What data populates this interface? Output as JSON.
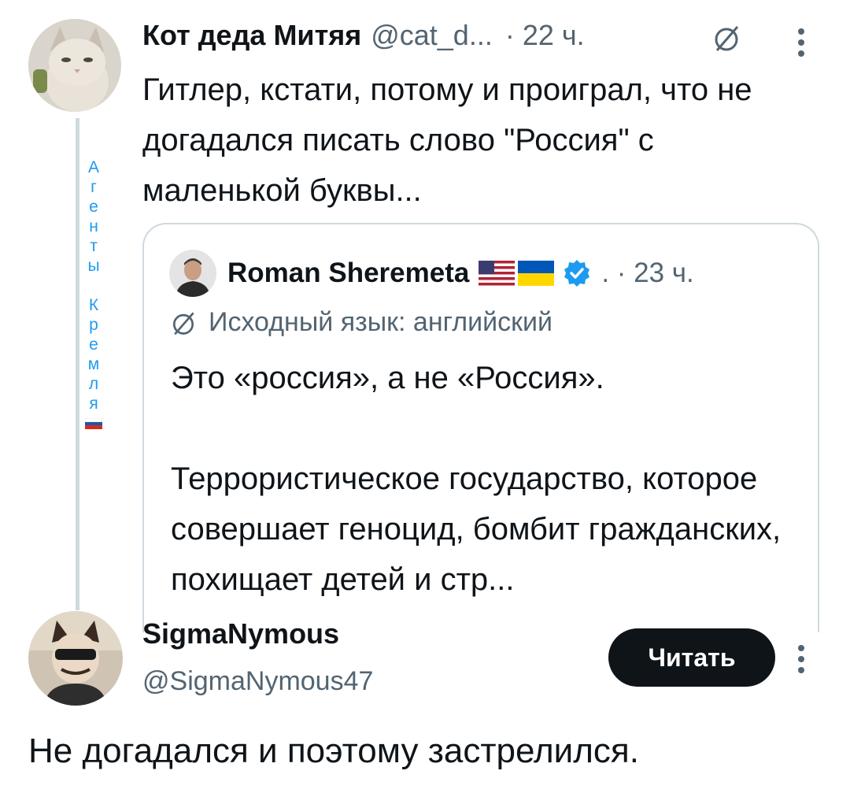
{
  "tweet1": {
    "display_name": "Кот деда Митяя",
    "handle": "@cat_d...",
    "time": "· 22 ч.",
    "text": "Гитлер, кстати, потому и проиграл, что не догадался писать слово \"Россия\" с маленькой буквы...",
    "side_label_letters": [
      "А",
      "г",
      "е",
      "н",
      "т",
      "ы",
      "",
      "К",
      "р",
      "е",
      "м",
      "л",
      "я"
    ],
    "icons": [
      "translate-icon",
      "more-icon"
    ]
  },
  "quote": {
    "display_name": "Roman Sheremeta",
    "time": ". · 23 ч.",
    "original_language": "Исходный язык: английский",
    "line1": "Это «россия», а не «Россия».",
    "text": "Террористическое государство, которое совершает геноцид, бомбит гражданских, похищает детей и стр...",
    "icons": [
      "us-flag-icon",
      "ukraine-flag-icon",
      "verified-badge-icon"
    ]
  },
  "tweet2": {
    "display_name": "SigmaNymous",
    "handle": "@SigmaNymous47",
    "follow_label": "Читать",
    "text": "Не догадался и поэтому застрелился."
  },
  "colors": {
    "accent": "#1d9bf0",
    "text": "#0f1419",
    "muted": "#536471",
    "border": "#cfd9de"
  }
}
